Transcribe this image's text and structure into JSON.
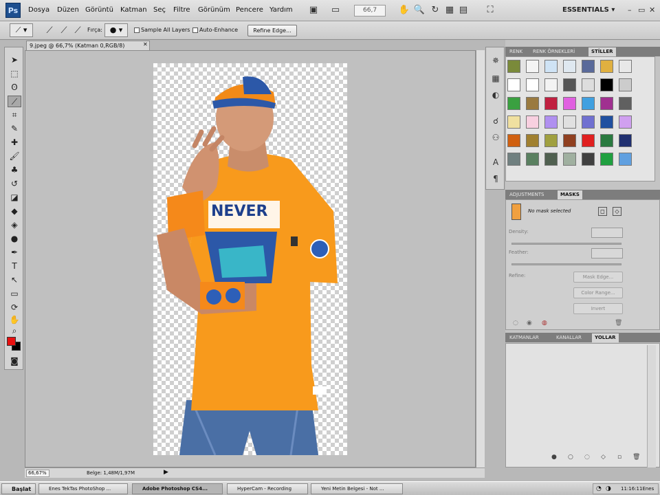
{
  "app": {
    "logo": "Ps"
  },
  "menu": [
    "Dosya",
    "Düzen",
    "Görüntü",
    "Katman",
    "Seç",
    "Filtre",
    "Görünüm",
    "Pencere",
    "Yardım"
  ],
  "menubar": {
    "zoom": "66,7",
    "workspace": "ESSENTIALS ▾"
  },
  "options": {
    "feather_label": "Fırça:",
    "sample_all_layers": "Sample All Layers",
    "auto_enhance": "Auto-Enhance",
    "refine_edge": "Refine Edge..."
  },
  "document": {
    "tab_title": "9.jpeg @ 66,7% (Katman 0,RGB/8)"
  },
  "status": {
    "zoom": "66,67%",
    "info": "Belge: 1,48M/1,97M"
  },
  "colors": {
    "foreground": "#e81010",
    "background": "#000000"
  },
  "styles_panel": {
    "tabs": [
      "RENK",
      "RENK ÖRNEKLERİ",
      "STİLLER"
    ],
    "active_tab": "STİLLER"
  },
  "masks_panel": {
    "tabs": [
      "ADJUSTMENTS",
      "MASKS"
    ],
    "active_tab": "MASKS",
    "no_mask": "No mask selected",
    "density": "Density:",
    "feather": "Feather:",
    "refine": "Refine:",
    "mask_edge": "Mask Edge...",
    "color_range": "Color Range...",
    "invert": "Invert"
  },
  "layers_panel": {
    "tabs": [
      "KATMANLAR",
      "KANALLAR",
      "YOLLAR"
    ],
    "active_tab": "YOLLAR"
  },
  "taskbar": {
    "start": "Başlat",
    "tasks": [
      "Enes TekTas PhotoShop ...",
      "Adobe Photoshop CS4...",
      "HyperCam - Recording",
      "Yeni Metin Belgesi - Not ..."
    ],
    "clock": "11:16:11Enes"
  }
}
